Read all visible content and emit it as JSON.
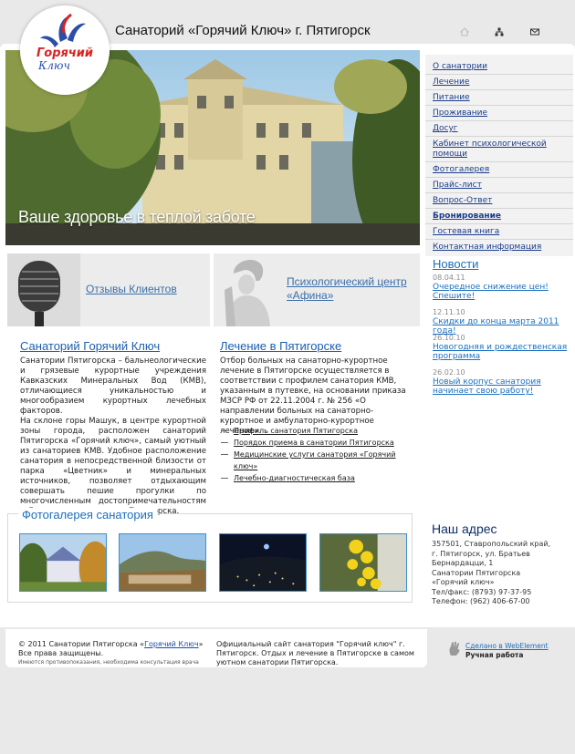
{
  "header": {
    "logo_text": "Горячий Ключ",
    "title": "Санаторий «Горячий Ключ» г. Пятигорск",
    "icons": [
      "home-icon",
      "sitemap-icon",
      "mail-icon"
    ]
  },
  "hero": {
    "caption": "Ваше здоровье в теплой заботе"
  },
  "nav": {
    "items": [
      {
        "label": "О санатории"
      },
      {
        "label": "Лечение"
      },
      {
        "label": "Питание"
      },
      {
        "label": "Проживание"
      },
      {
        "label": "Досуг"
      },
      {
        "label": "Кабинет психологической помощи"
      },
      {
        "label": "Фотогалерея"
      },
      {
        "label": "Прайс-лист"
      },
      {
        "label": "Вопрос-Ответ"
      },
      {
        "label": "Бронирование"
      },
      {
        "label": "Гостевая книга"
      },
      {
        "label": "Контактная информация"
      }
    ]
  },
  "promos": {
    "reviews": "Отзывы Клиентов",
    "psych": "Психологический центр «Афина»"
  },
  "news": {
    "title": "Новости",
    "items": [
      {
        "date": "08.04.11",
        "text": "Очередное снижение цен! Спешите!"
      },
      {
        "date": "12.11.10",
        "text": "Скидки до конца марта 2011 года!"
      },
      {
        "date": "26.10.10",
        "text": "Новогодняя и рождественская программа"
      },
      {
        "date": "26.02.10",
        "text": "Новый корпус санатория начинает свою работу!"
      }
    ]
  },
  "about": {
    "title": "Санаторий Горячий Ключ",
    "text": "Санатории Пятигорска – бальнеологические и грязевые курортные учреждения Кавказских Минеральных Вод (КМВ), отличающиеся уникальностью и многообразием курортных лечебных факторов.",
    "text2": "На склоне горы Машук, в центре курортной зоны города, расположен санаторий Пятигорска «Горячий ключ», самый уютный из санаториев КМВ. Удобное расположение санатория в непосредственной близости от парка «Цветник» и минеральных источников, позволяет отдыхающим совершать пешие прогулки по многочисленным достопримечательностям и Лермонтовским местам Пятигорска."
  },
  "treatment": {
    "title": "Лечение в Пятигорске",
    "text": "Отбор больных на санаторно-курортное лечение в Пятигорске осуществляется в соответствии с профилем санатория КМВ, указанным в путевке, на основании приказа МЗСР РФ от 22.11.2004 г. № 256 «О направлении больных на санаторно-курортное и амбулаторно-курортное лечение».",
    "links": [
      "Профиль санатория Пятигорска",
      "Порядок приема в санатории Пятигорска",
      "Медицинские услуги санатория «Горячий ключ»",
      "Лечебно-диагностическая база"
    ]
  },
  "gallery": {
    "title": "Фотогалерея санатория"
  },
  "address": {
    "title": "Наш адрес",
    "lines": [
      "357501, Ставропольский край,",
      "г. Пятигорск, ул. Братьев",
      "Бернардацци, 1",
      "Санатории Пятигорска",
      "«Горячий ключ»",
      "Тел/факс: (8793) 97-37-95",
      "Телефон: (962) 406-67-00"
    ]
  },
  "footer": {
    "copyright_prefix": "© 2011 Санатории Пятигорска «",
    "copyright_link": "Горячий Ключ",
    "copyright_suffix": "»",
    "rights": "Все права защищены.",
    "disclaimer": "Имеются противопоказания, необходима консультация врача",
    "official": "Официальный сайт санатория \"Горячий ключ\" г. Пятигорск. Отдых и лечение в Пятигорске в самом уютном санатории Пятигорска.",
    "made_by": "Сделано в WebElement",
    "manual": "Ручная работа"
  },
  "colors": {
    "link": "#1a6fbf",
    "title_dark": "#0f2f6a",
    "nav_bg": "#f2f2f2"
  }
}
